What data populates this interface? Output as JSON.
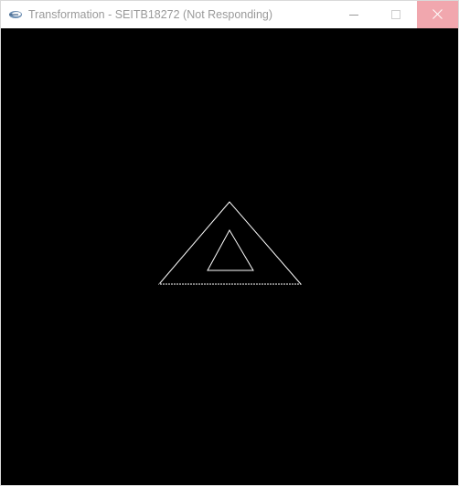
{
  "window": {
    "title": "Transformation - SEITB18272 (Not Responding)",
    "close_button_color": "#f1a7ae"
  },
  "icons": {
    "app": "eclipse-app-icon",
    "minimize": "minimize-icon",
    "maximize": "maximize-icon",
    "close": "close-icon"
  },
  "canvas": {
    "background": "#000000",
    "stroke_color": "#ffffff"
  }
}
